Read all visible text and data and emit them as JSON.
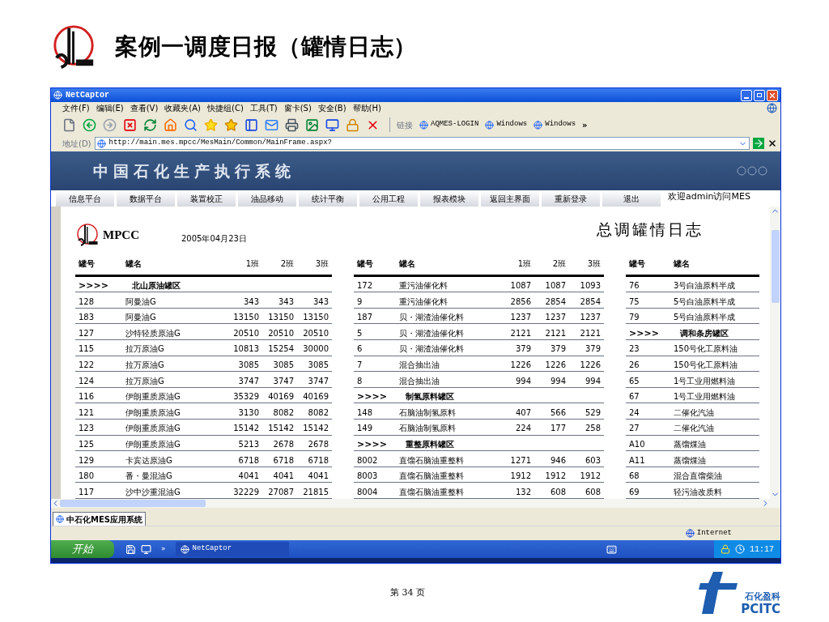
{
  "slide": {
    "title": "案例一调度日报（罐情日志）",
    "page": "第 34 页",
    "brand": {
      "cn": "石化盈科",
      "en": "PCITC"
    }
  },
  "window": {
    "title": "NetCaptor",
    "menu": [
      "文件(F)",
      "编辑(E)",
      "查看(V)",
      "收藏夹(A)",
      "快捷组(C)",
      "工具(T)",
      "窗卡(S)",
      "安全(B)",
      "帮助(H)"
    ],
    "links_label": "链接",
    "links": [
      "AQMES-LOGIN",
      "Windows",
      "Windows"
    ],
    "more": "»",
    "address_label": "地址(D)",
    "url": "http://main.mes.mpcc/MesMain/Common/MainFrame.aspx?"
  },
  "app": {
    "banner_title": "中国石化生产执行系统",
    "nav": [
      "信息平台",
      "数据平台",
      "装置校正",
      "油品移动",
      "统计平衡",
      "公用工程",
      "报表模块",
      "返回主界面",
      "重新登录",
      "退出"
    ],
    "welcome": "欢迎admin访问MES"
  },
  "report": {
    "org": "MPCC",
    "date": "2005年04月23日",
    "title": "总调罐情日志",
    "tables": [
      {
        "columns": [
          "罐号",
          "罐名",
          "1班",
          "2班",
          "3班"
        ],
        "rows": [
          {
            "kind": "section",
            "marker": ">>>>",
            "name": "北山原油罐区"
          },
          {
            "kind": "tank",
            "cells": [
              "128",
              "阿曼油G",
              "343",
              "343",
              "343"
            ]
          },
          {
            "kind": "tank",
            "cells": [
              "183",
              "阿曼油G",
              "13150",
              "13150",
              "13150"
            ]
          },
          {
            "kind": "tank",
            "cells": [
              "127",
              "沙特轻质原油G",
              "20510",
              "20510",
              "20510"
            ]
          },
          {
            "kind": "tank",
            "cells": [
              "115",
              "拉万原油G",
              "10813",
              "15254",
              "30000"
            ]
          },
          {
            "kind": "tank",
            "cells": [
              "122",
              "拉万原油G",
              "3085",
              "3085",
              "3085"
            ]
          },
          {
            "kind": "tank",
            "cells": [
              "124",
              "拉万原油G",
              "3747",
              "3747",
              "3747"
            ]
          },
          {
            "kind": "tank",
            "cells": [
              "116",
              "伊朗重质原油G",
              "35329",
              "40169",
              "40169"
            ]
          },
          {
            "kind": "tank",
            "cells": [
              "121",
              "伊朗重质原油G",
              "3130",
              "8082",
              "8082"
            ]
          },
          {
            "kind": "tank",
            "cells": [
              "123",
              "伊朗重质原油G",
              "15142",
              "15142",
              "15142"
            ]
          },
          {
            "kind": "tank",
            "cells": [
              "125",
              "伊朗重质原油G",
              "5213",
              "2678",
              "2678"
            ]
          },
          {
            "kind": "tank",
            "cells": [
              "129",
              "卡宾达原油G",
              "6718",
              "6718",
              "6718"
            ]
          },
          {
            "kind": "tank",
            "cells": [
              "180",
              "番・曼混油G",
              "4041",
              "4041",
              "4041"
            ]
          },
          {
            "kind": "tank",
            "cells": [
              "117",
              "沙中沙重混油G",
              "32229",
              "27087",
              "21815"
            ]
          }
        ]
      },
      {
        "columns": [
          "罐号",
          "罐名",
          "1班",
          "2班",
          "3班"
        ],
        "rows": [
          {
            "kind": "tank",
            "cells": [
              "172",
              "重污油催化料",
              "1087",
              "1087",
              "1093"
            ]
          },
          {
            "kind": "tank",
            "cells": [
              "9",
              "重污油催化料",
              "2856",
              "2854",
              "2854"
            ]
          },
          {
            "kind": "tank",
            "cells": [
              "187",
              "贝・湖渣油催化料",
              "1237",
              "1237",
              "1237"
            ]
          },
          {
            "kind": "tank",
            "cells": [
              "5",
              "贝・湖渣油催化料",
              "2121",
              "2121",
              "2121"
            ]
          },
          {
            "kind": "tank",
            "cells": [
              "6",
              "贝・湖渣油催化料",
              "379",
              "379",
              "379"
            ]
          },
          {
            "kind": "tank",
            "cells": [
              "7",
              "混合抽出油",
              "1226",
              "1226",
              "1226"
            ]
          },
          {
            "kind": "tank",
            "cells": [
              "8",
              "混合抽出油",
              "994",
              "994",
              "994"
            ]
          },
          {
            "kind": "section",
            "marker": ">>>>",
            "name": "制氢原料罐区"
          },
          {
            "kind": "tank",
            "cells": [
              "148",
              "石脑油制氢原料",
              "407",
              "566",
              "529"
            ]
          },
          {
            "kind": "tank",
            "cells": [
              "149",
              "石脑油制氢原料",
              "224",
              "177",
              "258"
            ]
          },
          {
            "kind": "section",
            "marker": ">>>>",
            "name": "重整原料罐区"
          },
          {
            "kind": "tank",
            "cells": [
              "8002",
              "直馏石脑油重整料",
              "1271",
              "946",
              "603"
            ]
          },
          {
            "kind": "tank",
            "cells": [
              "8003",
              "直馏石脑油重整料",
              "1912",
              "1912",
              "1912"
            ]
          },
          {
            "kind": "tank",
            "cells": [
              "8004",
              "直馏石脑油重整料",
              "132",
              "608",
              "608"
            ]
          }
        ]
      },
      {
        "columns": [
          "罐号",
          "罐名"
        ],
        "rows": [
          {
            "kind": "tank",
            "cells": [
              "76",
              "3号白油原料半成"
            ]
          },
          {
            "kind": "tank",
            "cells": [
              "75",
              "5号白油原料半成"
            ]
          },
          {
            "kind": "tank",
            "cells": [
              "79",
              "5号白油原料半成"
            ]
          },
          {
            "kind": "section",
            "marker": ">>>>",
            "name": "调和条房罐区"
          },
          {
            "kind": "tank",
            "cells": [
              "23",
              "150号化工原料油"
            ]
          },
          {
            "kind": "tank",
            "cells": [
              "26",
              "150号化工原料油"
            ]
          },
          {
            "kind": "tank",
            "cells": [
              "65",
              "1号工业用燃料油"
            ]
          },
          {
            "kind": "tank",
            "cells": [
              "67",
              "1号工业用燃料油"
            ]
          },
          {
            "kind": "tank",
            "cells": [
              "24",
              "二催化汽油"
            ]
          },
          {
            "kind": "tank",
            "cells": [
              "27",
              "二催化汽油"
            ]
          },
          {
            "kind": "tank",
            "cells": [
              "A10",
              "蒸馏煤油"
            ]
          },
          {
            "kind": "tank",
            "cells": [
              "A11",
              "蒸馏煤油"
            ]
          },
          {
            "kind": "tank",
            "cells": [
              "68",
              "混合直馏柴油"
            ]
          },
          {
            "kind": "tank",
            "cells": [
              "69",
              "轻污油改质料"
            ]
          }
        ]
      }
    ]
  },
  "doc_tab": "中石化MES应用系统",
  "status_bar": {
    "zone": "Internet"
  },
  "taskbar": {
    "start": "开始",
    "tasks": [
      "NetCaptor"
    ],
    "more": "»",
    "clock": "11:17"
  }
}
